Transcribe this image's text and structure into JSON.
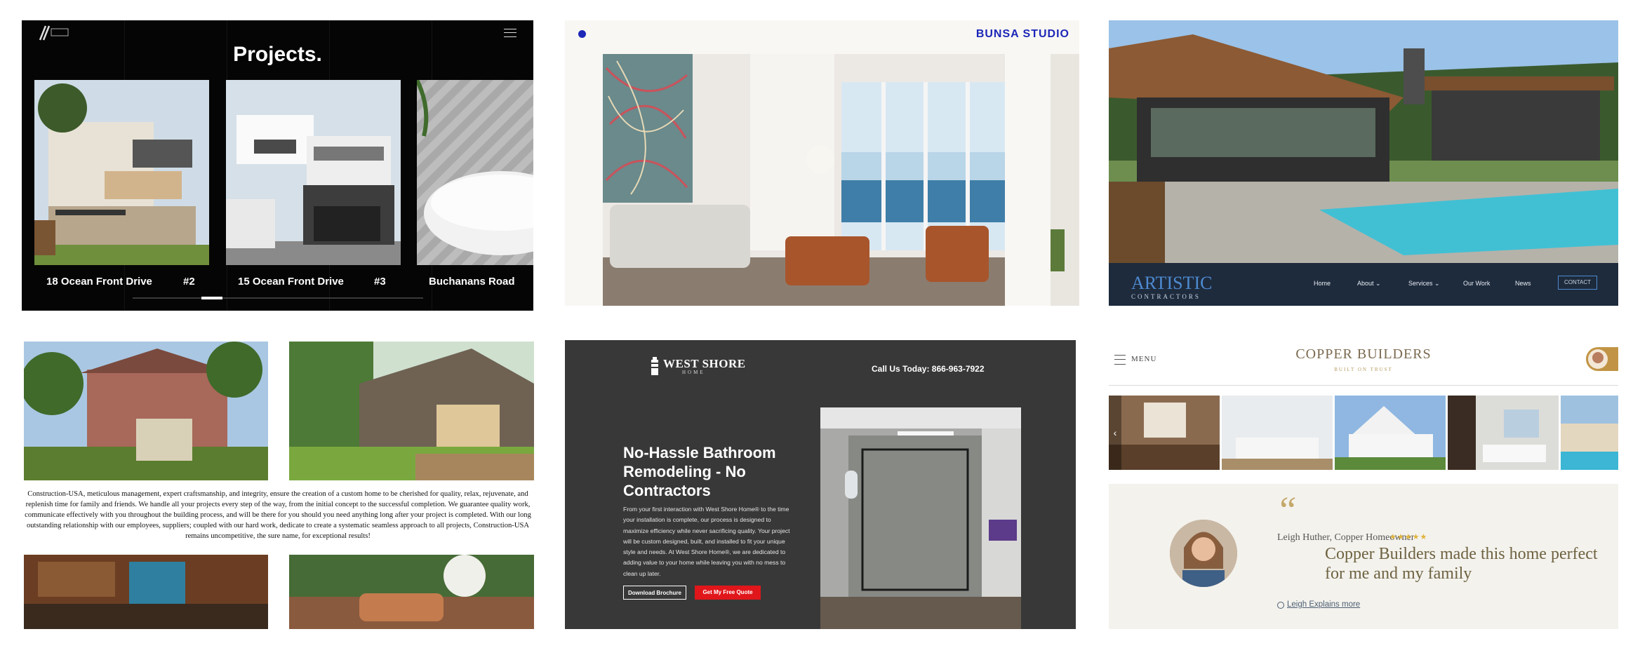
{
  "panel1": {
    "title": "Projects.",
    "cards": [
      {
        "caption": "18 Ocean Front Drive",
        "number": "#2"
      },
      {
        "caption": "15 Ocean Front Drive",
        "number": "#3"
      },
      {
        "caption": "Buchanans Road",
        "number": ""
      }
    ],
    "slider_position": 0.25
  },
  "panel2": {
    "brand": "BUNSA STUDIO",
    "accent": "#1d27b8"
  },
  "panel3": {
    "logo_main": "ARTISTIC",
    "logo_sub": "CONTRACTORS",
    "nav": [
      "Home",
      "About ⌄",
      "Services ⌄",
      "Our Work",
      "News"
    ],
    "contact": "CONTACT"
  },
  "panel4": {
    "paragraph": "Construction-USA, meticulous management, expert craftsmanship, and integrity, ensure the creation of a custom home to be cherished for quality, relax, rejuvenate, and replenish time for family and friends. We handle all your projects every step of the way, from the initial concept to the successful completion. We guarantee quality work, communicate effectively with you throughout the building process, and will be there for you should you need anything long after your project is completed. With our long outstanding relationship with our employees, suppliers; coupled with our hard work, dedicate to create a systematic seamless approach to all projects, Construction-USA remains uncompetitive, the sure name, for exceptional results!"
  },
  "panel5": {
    "logo": "WEST SHORE",
    "logo_sub": "HOME",
    "phone": "Call Us Today: 866-963-7922",
    "headline": "No-Hassle Bathroom Remodeling - No Contractors",
    "body": "From your first interaction with West Shore Home® to the time your installation is complete, our process is designed to maximize efficiency while never sacrificing quality. Your project will be custom designed, built, and installed to fit your unique style and needs. At West Shore Home®, we are dedicated to adding value to your home while leaving you with no mess to clean up later.",
    "button_download": "Download Brochure",
    "button_quote": "Get My Free Quote",
    "cta_color": "#e0161b"
  },
  "panel6": {
    "menu": "MENU",
    "brand": "COPPER BUILDERS",
    "tagline": "BUILT ON TRUST",
    "testimonial_name": "Leigh Huther, Copper Homeowner",
    "stars": "★★★★★",
    "quote_mark": "“",
    "quote": "Copper Builders made this home perfect for me and my family",
    "more_link": "Leigh Explains more",
    "accent": "#c4a869"
  }
}
